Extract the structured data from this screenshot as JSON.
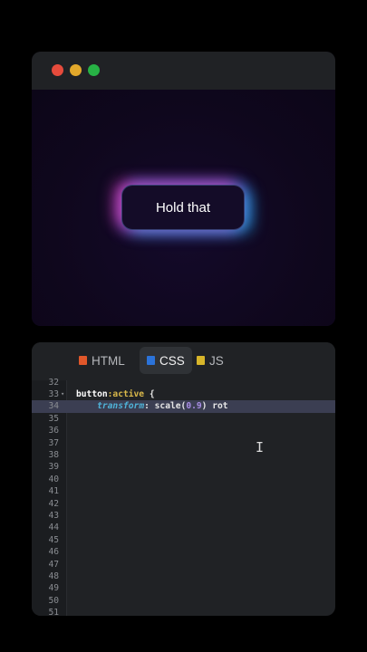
{
  "preview": {
    "button_label": "Hold that",
    "glow_colors": [
      "#dc46c8",
      "#28aaf0"
    ]
  },
  "window_controls": [
    "close-dot",
    "minimize-dot",
    "maximize-dot"
  ],
  "editor": {
    "tabs": [
      {
        "label": "HTML",
        "icon": "html5-icon",
        "active": false
      },
      {
        "label": "CSS",
        "icon": "css3-icon",
        "active": true
      },
      {
        "label": "JS",
        "icon": "js-icon",
        "active": false
      }
    ],
    "lines": [
      {
        "n": "32",
        "code": ""
      },
      {
        "n": "33",
        "code": "button:active {",
        "fold": "▾"
      },
      {
        "n": "34",
        "code": "    transform: scale(0.9) rot",
        "highlight": true
      },
      {
        "n": "35",
        "code": ""
      },
      {
        "n": "36",
        "code": ""
      },
      {
        "n": "37",
        "code": ""
      },
      {
        "n": "38",
        "code": ""
      },
      {
        "n": "39",
        "code": ""
      },
      {
        "n": "40",
        "code": ""
      },
      {
        "n": "41",
        "code": ""
      },
      {
        "n": "42",
        "code": ""
      },
      {
        "n": "43",
        "code": ""
      },
      {
        "n": "44",
        "code": ""
      },
      {
        "n": "45",
        "code": ""
      },
      {
        "n": "46",
        "code": ""
      },
      {
        "n": "47",
        "code": ""
      },
      {
        "n": "48",
        "code": ""
      },
      {
        "n": "49",
        "code": ""
      },
      {
        "n": "50",
        "code": ""
      },
      {
        "n": "51",
        "code": ""
      }
    ],
    "syntax": {
      "selector": "button",
      "pseudo": ":active",
      "brace": " {",
      "property": "transform",
      "colon": ": ",
      "func_open": "scale(",
      "number": "0.9",
      "func_rest": ") rot"
    }
  }
}
